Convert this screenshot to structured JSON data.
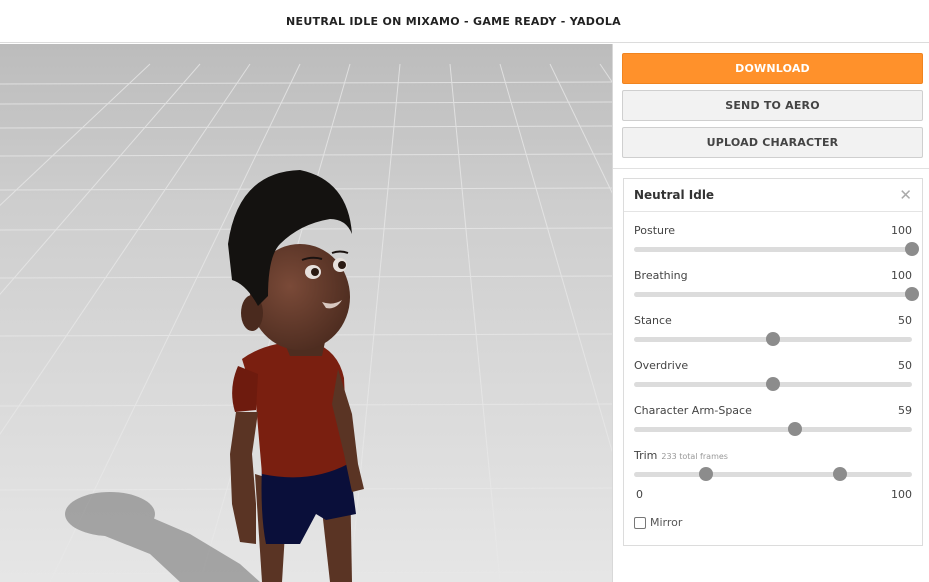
{
  "header": {
    "title": "NEUTRAL IDLE ON MIXAMO - GAME READY - YADOLA"
  },
  "actions": {
    "download_label": "DOWNLOAD",
    "send_label": "SEND TO AERO",
    "upload_label": "UPLOAD CHARACTER"
  },
  "panel": {
    "title": "Neutral Idle",
    "close_icon": "close-icon",
    "sliders": [
      {
        "label": "Posture",
        "value": "100",
        "fraction": 1.0
      },
      {
        "label": "Breathing",
        "value": "100",
        "fraction": 1.0
      },
      {
        "label": "Stance",
        "value": "50",
        "fraction": 0.5
      },
      {
        "label": "Overdrive",
        "value": "50",
        "fraction": 0.5
      },
      {
        "label": "Character Arm-Space",
        "value": "59",
        "fraction": 0.58
      }
    ],
    "trim": {
      "label": "Trim",
      "sub": "233 total frames",
      "min_label": "0",
      "max_label": "100",
      "start_fraction": 0.26,
      "end_fraction": 0.74
    },
    "mirror_label": "Mirror"
  },
  "colors": {
    "accent": "#ff912b",
    "thumb": "#8c8c8c",
    "track": "#dcdcdc"
  }
}
